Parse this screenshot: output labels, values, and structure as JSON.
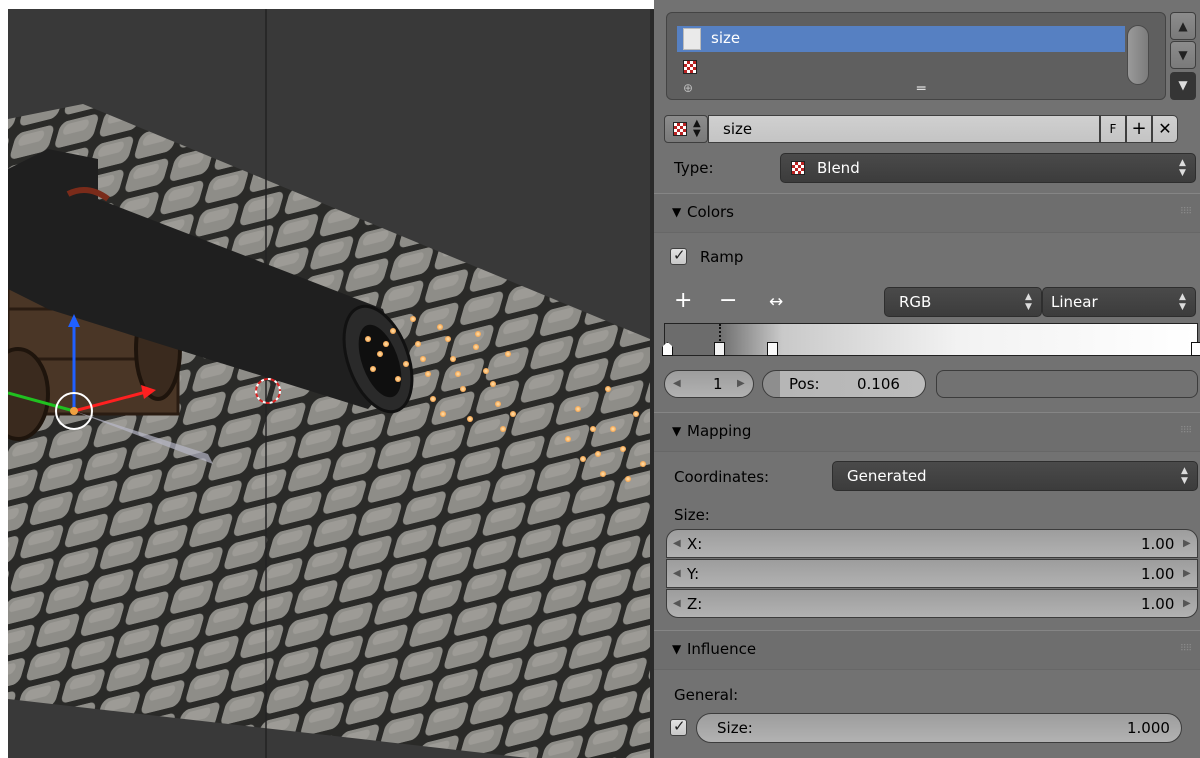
{
  "texture_slots": {
    "selected_label": "size",
    "add_symbol": "⊕",
    "drag_symbol": "═"
  },
  "texture_selector": {
    "name": "size",
    "fake_user_label": "F",
    "new_symbol": "+",
    "unlink_symbol": "✕"
  },
  "type_row": {
    "label": "Type:",
    "value": "Blend"
  },
  "colors": {
    "header": "Colors",
    "ramp_label": "Ramp",
    "ramp_checked": true,
    "add_symbol": "+",
    "remove_symbol": "−",
    "flip_symbol": "↔",
    "color_mode": "RGB",
    "interpolation": "Linear",
    "active_index": "1",
    "pos_label": "Pos:",
    "pos_value": "0.106"
  },
  "mapping": {
    "header": "Mapping",
    "coordinates_label": "Coordinates:",
    "coordinates_value": "Generated",
    "size_label": "Size:",
    "x_label": "X:",
    "x_value": "1.00",
    "y_label": "Y:",
    "y_value": "1.00",
    "z_label": "Z:",
    "z_value": "1.00"
  },
  "influence": {
    "header": "Influence",
    "general_label": "General:",
    "size_label": "Size:",
    "size_value": "1.000",
    "size_checked": true
  },
  "colors_accent": {
    "selection": "#5680c2",
    "panel_bg": "#727272",
    "viewport_bg": "#393939"
  }
}
